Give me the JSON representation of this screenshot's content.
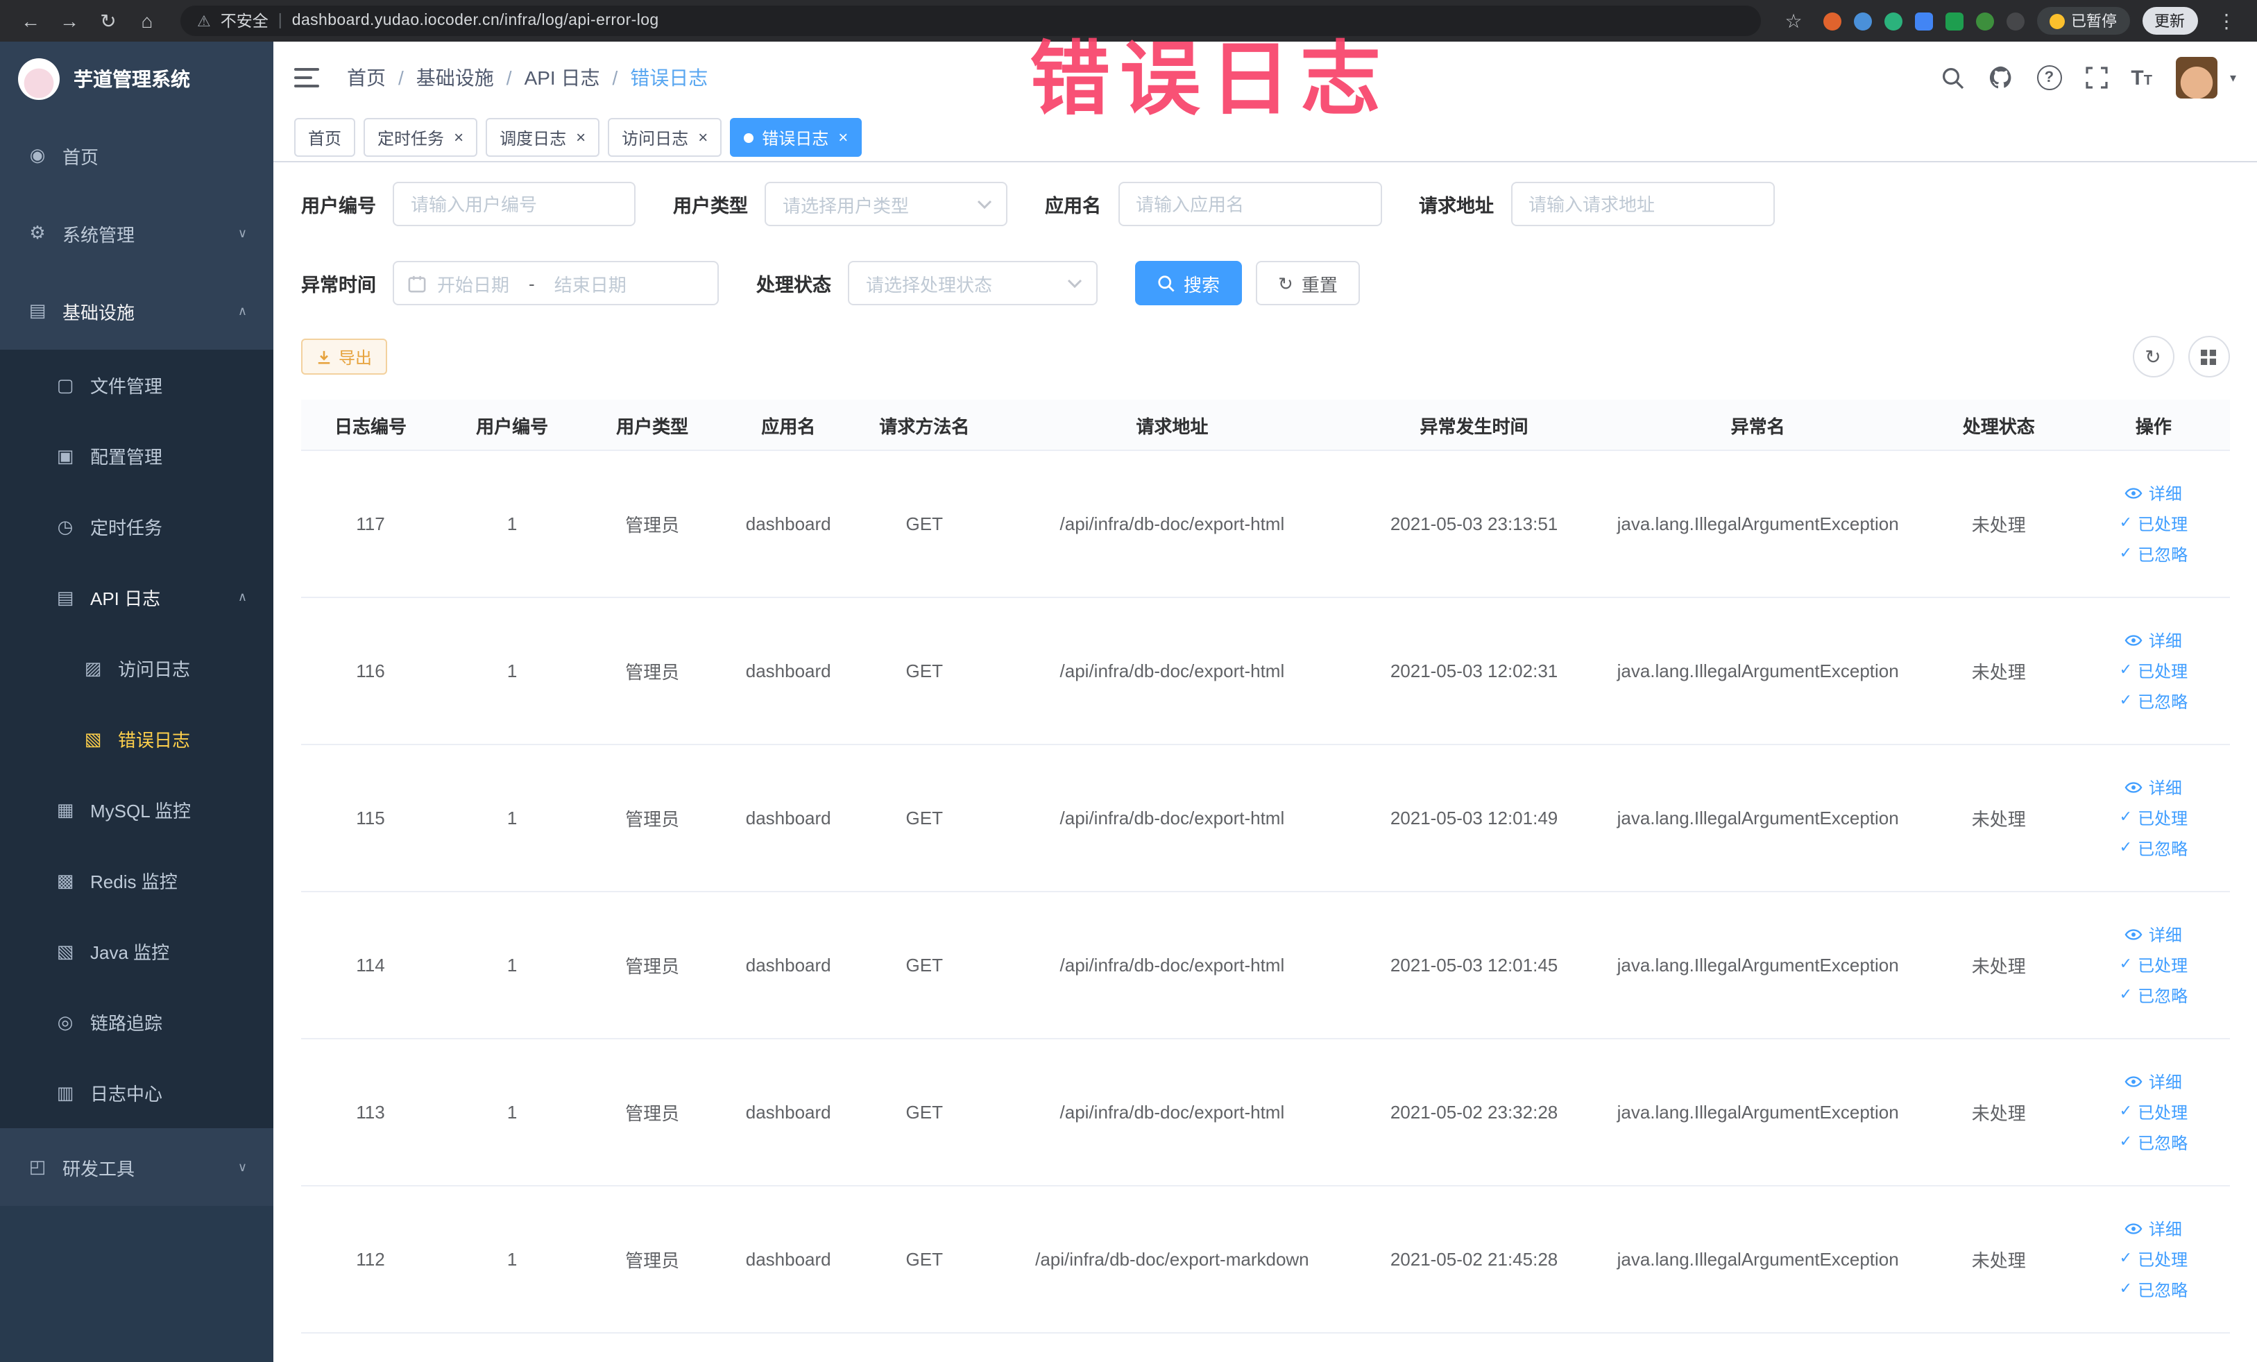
{
  "watermark": "错误日志",
  "browser": {
    "security_label": "不安全",
    "url": "dashboard.yudao.iocoder.cn/infra/log/api-error-log",
    "paused_badge": "已暂停",
    "update_button": "更新"
  },
  "sidebar": {
    "logo_title": "芋道管理系统",
    "home": "首页",
    "system_management": "系统管理",
    "infrastructure": "基础设施",
    "file_management": "文件管理",
    "config_management": "配置管理",
    "scheduled_jobs": "定时任务",
    "api_logs": "API 日志",
    "access_log": "访问日志",
    "error_log": "错误日志",
    "mysql_monitor": "MySQL 监控",
    "redis_monitor": "Redis 监控",
    "java_monitor": "Java 监控",
    "trace": "链路追踪",
    "log_center": "日志中心",
    "dev_tools": "研发工具"
  },
  "breadcrumb": [
    "首页",
    "基础设施",
    "API 日志",
    "错误日志"
  ],
  "tabs": [
    {
      "label": "首页"
    },
    {
      "label": "定时任务"
    },
    {
      "label": "调度日志"
    },
    {
      "label": "访问日志"
    },
    {
      "label": "错误日志"
    }
  ],
  "filters": {
    "user_id_label": "用户编号",
    "user_id_placeholder": "请输入用户编号",
    "user_type_label": "用户类型",
    "user_type_placeholder": "请选择用户类型",
    "app_name_label": "应用名",
    "app_name_placeholder": "请输入应用名",
    "request_url_label": "请求地址",
    "request_url_placeholder": "请输入请求地址",
    "exception_time_label": "异常时间",
    "date_start_placeholder": "开始日期",
    "date_separator": "-",
    "date_end_placeholder": "结束日期",
    "process_status_label": "处理状态",
    "process_status_placeholder": "请选择处理状态",
    "search_button": "搜索",
    "reset_button": "重置"
  },
  "toolbar": {
    "export_button": "导出"
  },
  "table": {
    "headers": [
      "日志编号",
      "用户编号",
      "用户类型",
      "应用名",
      "请求方法名",
      "请求地址",
      "异常发生时间",
      "异常名",
      "处理状态",
      "操作"
    ],
    "actions": {
      "detail": "详细",
      "processed": "已处理",
      "ignored": "已忽略"
    },
    "rows": [
      {
        "id": "117",
        "user_id": "1",
        "user_type": "管理员",
        "app": "dashboard",
        "method": "GET",
        "url": "/api/infra/db-doc/export-html",
        "time": "2021-05-03 23:13:51",
        "exception": "java.lang.IllegalArgumentException",
        "status": "未处理"
      },
      {
        "id": "116",
        "user_id": "1",
        "user_type": "管理员",
        "app": "dashboard",
        "method": "GET",
        "url": "/api/infra/db-doc/export-html",
        "time": "2021-05-03 12:02:31",
        "exception": "java.lang.IllegalArgumentException",
        "status": "未处理"
      },
      {
        "id": "115",
        "user_id": "1",
        "user_type": "管理员",
        "app": "dashboard",
        "method": "GET",
        "url": "/api/infra/db-doc/export-html",
        "time": "2021-05-03 12:01:49",
        "exception": "java.lang.IllegalArgumentException",
        "status": "未处理"
      },
      {
        "id": "114",
        "user_id": "1",
        "user_type": "管理员",
        "app": "dashboard",
        "method": "GET",
        "url": "/api/infra/db-doc/export-html",
        "time": "2021-05-03 12:01:45",
        "exception": "java.lang.IllegalArgumentException",
        "status": "未处理"
      },
      {
        "id": "113",
        "user_id": "1",
        "user_type": "管理员",
        "app": "dashboard",
        "method": "GET",
        "url": "/api/infra/db-doc/export-html",
        "time": "2021-05-02 23:32:28",
        "exception": "java.lang.IllegalArgumentException",
        "status": "未处理"
      },
      {
        "id": "112",
        "user_id": "1",
        "user_type": "管理员",
        "app": "dashboard",
        "method": "GET",
        "url": "/api/infra/db-doc/export-markdown",
        "time": "2021-05-02 21:45:28",
        "exception": "java.lang.IllegalArgumentException",
        "status": "未处理"
      }
    ]
  }
}
